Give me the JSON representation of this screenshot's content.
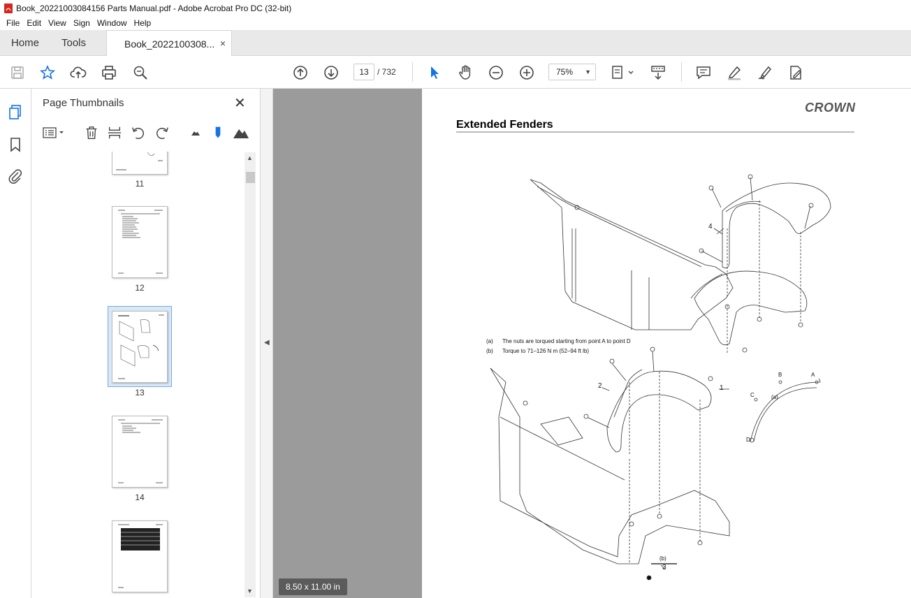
{
  "window": {
    "title": "Book_20221003084156 Parts Manual.pdf - Adobe Acrobat Pro DC (32-bit)"
  },
  "menu": [
    "File",
    "Edit",
    "View",
    "Sign",
    "Window",
    "Help"
  ],
  "tabs": {
    "home": "Home",
    "tools": "Tools",
    "document": "Book_2022100308...",
    "close": "×"
  },
  "toolbar": {
    "page_current": "13",
    "page_total": "/ 732",
    "zoom": "75%",
    "icons": [
      "save-icon",
      "star-icon",
      "upload-icon",
      "print-icon",
      "search-zoom-icon",
      "page-up-icon",
      "page-down-icon",
      "select-cursor-icon",
      "hand-icon",
      "zoom-out-icon",
      "zoom-in-icon",
      "page-fit-icon",
      "scroll-mode-icon",
      "comment-icon",
      "highlight-icon",
      "sign-icon",
      "edit-pdf-icon"
    ]
  },
  "left_rail": {
    "icons": [
      "thumbnails-icon",
      "bookmark-icon",
      "attachment-icon"
    ]
  },
  "thumbnails": {
    "title": "Page Thumbnails",
    "close": "✕",
    "tools": [
      "options-icon",
      "delete-icon",
      "extract-icon",
      "rotate-ccw-icon",
      "rotate-cw-icon",
      "small-thumbs-icon",
      "marker-icon",
      "large-thumbs-icon"
    ],
    "pages": [
      {
        "label": "11"
      },
      {
        "label": "12"
      },
      {
        "label": "13"
      },
      {
        "label": "14"
      },
      {
        "label": ""
      }
    ],
    "selected": "13"
  },
  "document": {
    "brand": "CROWN",
    "title": "Extended Fenders",
    "notes": [
      {
        "tag": "(a)",
        "text": "The nuts are torqued starting from point A to point D"
      },
      {
        "tag": "(b)",
        "text": "Torque to 71–126 N m (52–94 ft lb)"
      }
    ],
    "callouts": [
      "4",
      "2",
      "1",
      "3",
      "A",
      "B",
      "C",
      "D",
      "(a)",
      "(b)"
    ],
    "page_size": "8.50 x 11.00 in"
  },
  "colors": {
    "accent": "#1473e6",
    "docbg": "#9b9b9b",
    "tabbar": "#e9e9e9"
  }
}
